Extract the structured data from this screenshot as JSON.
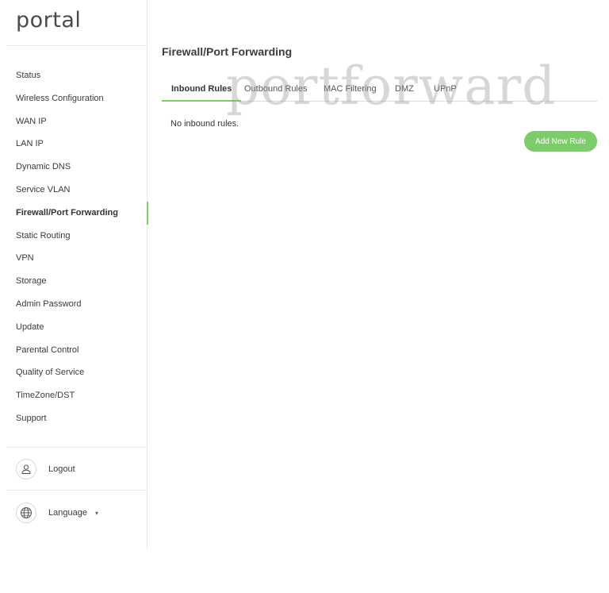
{
  "brand": {
    "logo_text": "portal"
  },
  "sidebar": {
    "items": [
      {
        "label": "Status"
      },
      {
        "label": "Wireless Configuration"
      },
      {
        "label": "WAN IP"
      },
      {
        "label": "LAN IP"
      },
      {
        "label": "Dynamic DNS"
      },
      {
        "label": "Service VLAN"
      },
      {
        "label": "Firewall/Port Forwarding",
        "active": true
      },
      {
        "label": "Static Routing"
      },
      {
        "label": "VPN"
      },
      {
        "label": "Storage"
      },
      {
        "label": "Admin Password"
      },
      {
        "label": "Update"
      },
      {
        "label": "Parental Control"
      },
      {
        "label": "Quality of Service"
      },
      {
        "label": "TimeZone/DST"
      },
      {
        "label": "Support"
      }
    ],
    "logout": {
      "label": "Logout",
      "icon": "user-icon"
    },
    "language": {
      "label": "Language",
      "icon": "globe-icon",
      "caret": "▾"
    }
  },
  "main": {
    "title": "Firewall/Port Forwarding",
    "tabs": [
      {
        "label": "Inbound Rules",
        "active": true
      },
      {
        "label": "Outbound Rules"
      },
      {
        "label": "MAC Filtering"
      },
      {
        "label": "DMZ"
      },
      {
        "label": "UPnP"
      }
    ],
    "empty_message": "No inbound rules.",
    "add_button_label": "Add New Rule"
  },
  "watermark": "portforward",
  "colors": {
    "accent": "#7ccc6b",
    "border": "#e6e6e6",
    "text": "#3a3a3a"
  }
}
